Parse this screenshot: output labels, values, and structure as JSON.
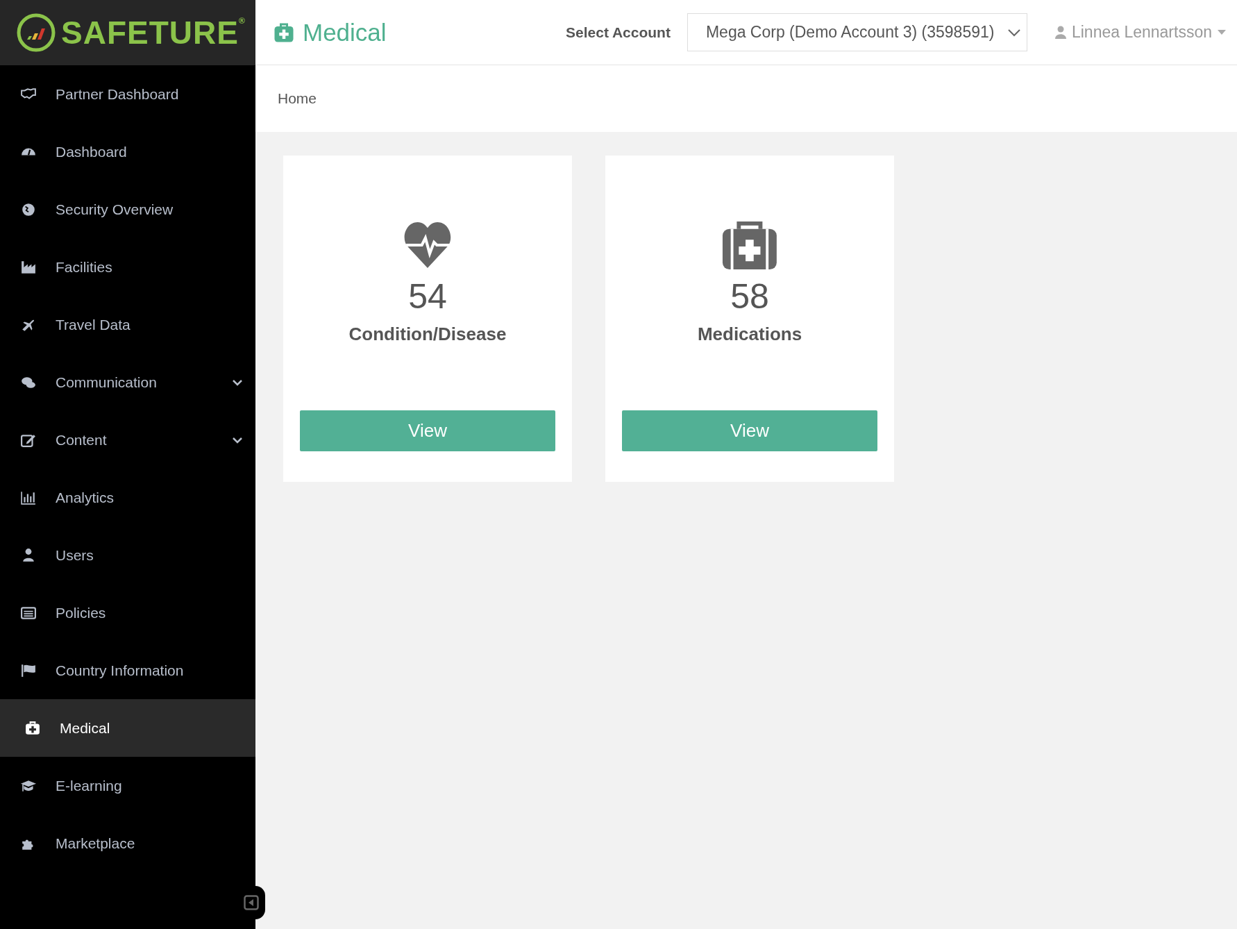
{
  "brand": {
    "name": "SAFETURE",
    "mark": "®"
  },
  "header": {
    "title": "Medical",
    "account_label": "Select Account",
    "account_value": "Mega Corp (Demo Account 3) (3598591)",
    "user": "Linnea Lennartsson"
  },
  "sidebar": {
    "items": [
      {
        "label": "Partner Dashboard",
        "selected": false,
        "expandable": false
      },
      {
        "label": "Dashboard",
        "selected": false,
        "expandable": false
      },
      {
        "label": "Security Overview",
        "selected": false,
        "expandable": false
      },
      {
        "label": "Facilities",
        "selected": false,
        "expandable": false
      },
      {
        "label": "Travel Data",
        "selected": false,
        "expandable": false
      },
      {
        "label": "Communication",
        "selected": false,
        "expandable": true
      },
      {
        "label": "Content",
        "selected": false,
        "expandable": true
      },
      {
        "label": "Analytics",
        "selected": false,
        "expandable": false
      },
      {
        "label": "Users",
        "selected": false,
        "expandable": false
      },
      {
        "label": "Policies",
        "selected": false,
        "expandable": false
      },
      {
        "label": "Country Information",
        "selected": false,
        "expandable": false
      },
      {
        "label": "Medical",
        "selected": true,
        "expandable": false
      },
      {
        "label": "E-learning",
        "selected": false,
        "expandable": false
      },
      {
        "label": "Marketplace",
        "selected": false,
        "expandable": false
      }
    ]
  },
  "breadcrumb": [
    "Home"
  ],
  "cards": [
    {
      "kind": "heart",
      "count": "54",
      "label": "Condition/Disease",
      "button": "View"
    },
    {
      "kind": "kit",
      "count": "58",
      "label": "Medications",
      "button": "View"
    }
  ]
}
